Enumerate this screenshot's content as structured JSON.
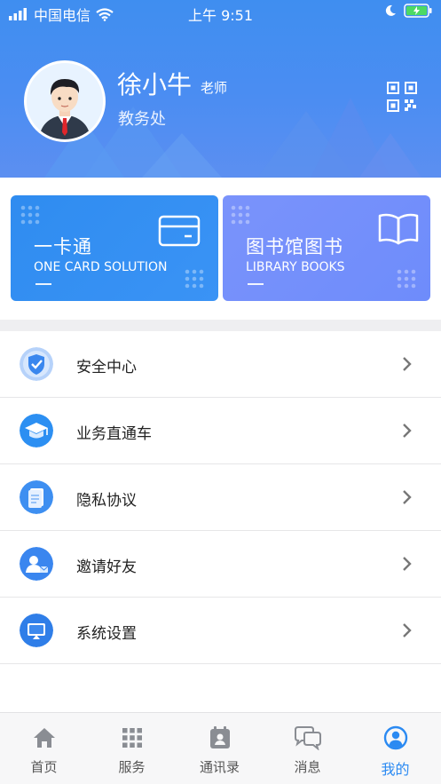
{
  "status_bar": {
    "carrier": "中国电信",
    "time": "上午 9:51"
  },
  "profile": {
    "name": "徐小牛",
    "role": "老师",
    "department": "教务处",
    "qr_icon": "qr-code-icon"
  },
  "cards": [
    {
      "title": "一卡通",
      "subtitle": "ONE CARD SOLUTION",
      "icon": "card-icon",
      "color": "#3a93f5"
    },
    {
      "title": "图书馆图书",
      "subtitle": "LIBRARY BOOKS",
      "icon": "book-icon",
      "color": "#7390fb"
    }
  ],
  "menu": {
    "items": [
      {
        "label": "安全中心",
        "icon": "shield-icon"
      },
      {
        "label": "业务直通车",
        "icon": "graduation-cap-icon"
      },
      {
        "label": "隐私协议",
        "icon": "document-icon"
      },
      {
        "label": "邀请好友",
        "icon": "invite-user-icon"
      },
      {
        "label": "系统设置",
        "icon": "monitor-icon"
      }
    ]
  },
  "tabbar": {
    "tabs": [
      {
        "label": "首页",
        "icon": "home-icon"
      },
      {
        "label": "服务",
        "icon": "grid-icon"
      },
      {
        "label": "通讯录",
        "icon": "contacts-icon"
      },
      {
        "label": "消息",
        "icon": "chat-icon"
      },
      {
        "label": "我的",
        "icon": "user-icon",
        "active": true
      }
    ]
  },
  "colors": {
    "accent": "#2b8af2",
    "header": "#4b8df2"
  }
}
